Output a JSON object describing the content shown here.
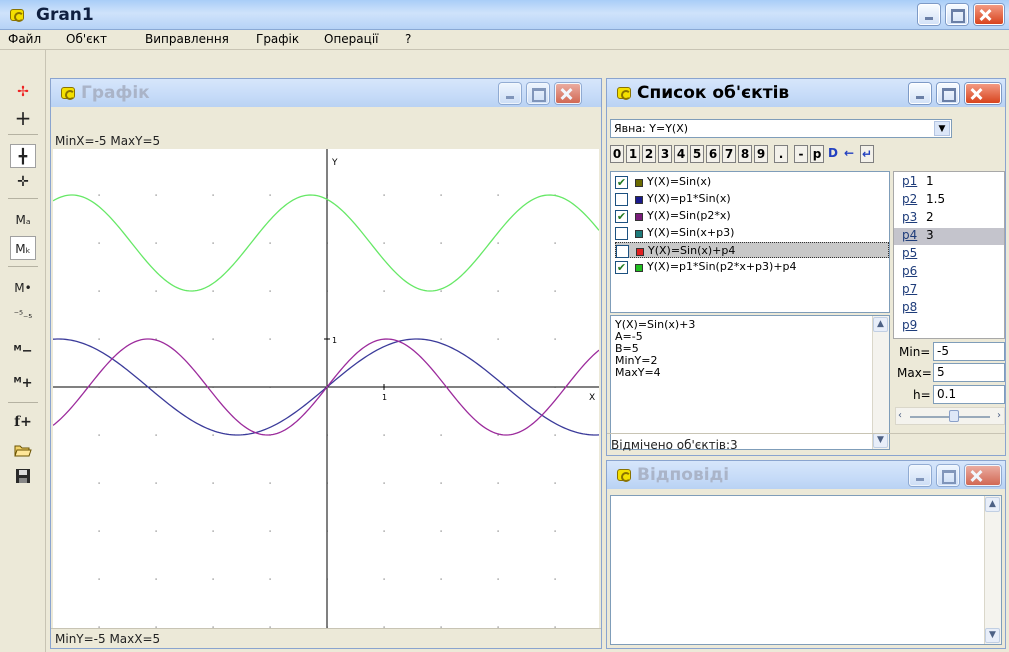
{
  "app": {
    "title": "Gran1"
  },
  "menu": [
    "Файл",
    "Об'єкт",
    "Виправлення",
    "Графік",
    "Операції",
    "?"
  ],
  "toolbar": {
    "buttons": [
      {
        "name": "draw-function-icon",
        "glyph": "✢"
      },
      {
        "name": "axes-cross-icon",
        "glyph": "+"
      },
      {
        "name": "axes-shift-icon",
        "glyph": "╋"
      },
      {
        "name": "axes-tilt-icon",
        "glyph": "✛"
      },
      {
        "name": "scale-auto-icon",
        "glyph": "Mₐ"
      },
      {
        "name": "scale-k-icon",
        "glyph": "Mₖ"
      },
      {
        "name": "scale-point-icon",
        "glyph": "M•"
      },
      {
        "name": "grid-scale-icon",
        "glyph": "⁻⁵₋₅"
      },
      {
        "name": "zoom-out-icon",
        "glyph": "ᴹ−"
      },
      {
        "name": "zoom-in-icon",
        "glyph": "ᴹ+"
      },
      {
        "name": "add-function-icon",
        "glyph": "f+"
      },
      {
        "name": "open-folder-icon",
        "glyph": ""
      },
      {
        "name": "save-floppy-icon",
        "glyph": ""
      }
    ]
  },
  "graph_window": {
    "title": "Графік",
    "top_status": "MinX=-5  MaxY=5",
    "bottom_status": "MinY=-5  MaxX=5",
    "x_label": "X",
    "y_label": "Y",
    "tick_label_x": "1",
    "tick_label_y": "1"
  },
  "chart_data": {
    "type": "line",
    "xlim": [
      -5,
      5
    ],
    "ylim": [
      -5,
      5
    ],
    "grid": "dotted",
    "xlabel": "X",
    "ylabel": "Y",
    "series": [
      {
        "name": "Y(X)=Sin(x)",
        "color": "#3b3b9a",
        "function": "sin(x)",
        "p": {}
      },
      {
        "name": "Y(X)=Sin(p2*x)",
        "color": "#9c2b9c",
        "function": "sin(p2*x)",
        "p": {
          "p2": 1.5
        }
      },
      {
        "name": "Y(X)=p1*Sin(p2*x+p3)+p4",
        "color": "#66e866",
        "function": "p1*sin(p2*x+p3)+p4",
        "p": {
          "p1": 1,
          "p2": 1.5,
          "p3": 2,
          "p4": 3
        }
      }
    ]
  },
  "object_list_window": {
    "title": "Список об'єктів",
    "type_select": "Явна: Y=Y(X)",
    "keypad": [
      "0",
      "1",
      "2",
      "3",
      "4",
      "5",
      "6",
      "7",
      "8",
      "9",
      ".",
      "-",
      "p",
      "D",
      "←",
      "↵"
    ],
    "objects": [
      {
        "checked": true,
        "color": "#6b6b00",
        "label": "Y(X)=Sin(x)",
        "selected": false
      },
      {
        "checked": false,
        "color": "#1a1a8c",
        "label": "Y(X)=p1*Sin(x)",
        "selected": false
      },
      {
        "checked": true,
        "color": "#7a1d7a",
        "label": "Y(X)=Sin(p2*x)",
        "selected": false
      },
      {
        "checked": false,
        "color": "#1d7a7a",
        "label": "Y(X)=Sin(x+p3)",
        "selected": false
      },
      {
        "checked": false,
        "color": "#e02020",
        "label": "Y(X)=Sin(x)+p4",
        "selected": true
      },
      {
        "checked": true,
        "color": "#20c020",
        "label": "Y(X)=p1*Sin(p2*x+p3)+p4",
        "selected": false
      }
    ],
    "details": [
      "Y(X)=Sin(x)+3",
      "A=-5",
      "B=5",
      "MinY=2",
      "MaxY=4"
    ],
    "params": [
      {
        "name": "p1",
        "value": "1"
      },
      {
        "name": "p2",
        "value": "1.5"
      },
      {
        "name": "p3",
        "value": "2"
      },
      {
        "name": "p4",
        "value": "3"
      },
      {
        "name": "p5",
        "value": ""
      },
      {
        "name": "p6",
        "value": ""
      },
      {
        "name": "p7",
        "value": ""
      },
      {
        "name": "p8",
        "value": ""
      },
      {
        "name": "p9",
        "value": ""
      }
    ],
    "min_label": "Min=",
    "min_value": "-5",
    "max_label": "Max=",
    "max_value": "5",
    "h_label": "h=",
    "h_value": "0.1",
    "slider_level": 0.55,
    "status": "Відмічено об'єктів:3"
  },
  "answers_window": {
    "title": "Відповіді"
  }
}
